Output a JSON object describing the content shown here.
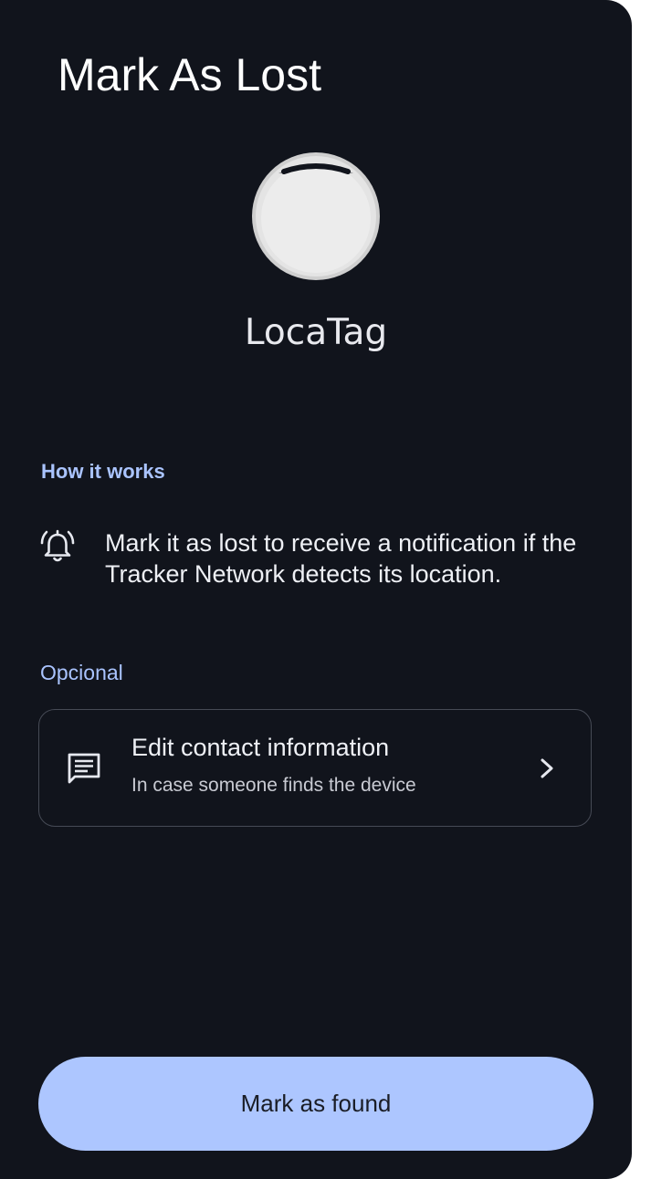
{
  "header": {
    "title": "Mark As Lost"
  },
  "device": {
    "name": "LocaTag",
    "image_icon": "round-tracker-tag-image"
  },
  "how_it_works": {
    "heading": "How it works",
    "icon": "alarm-bell-icon",
    "text": "Mark it as lost to receive a notification if the Tracker Network detects its location."
  },
  "optional": {
    "label": "Opcional",
    "card": {
      "icon": "message-icon",
      "title": "Edit contact information",
      "subtitle": "In case someone finds the device",
      "chevron_icon": "chevron-right-icon"
    }
  },
  "actions": {
    "primary_label": "Mark as found"
  },
  "colors": {
    "background": "#11141c",
    "accent": "#aac4ff",
    "button": "#adc6ff",
    "button_text": "#1a1d26",
    "card_border": "#464a55"
  }
}
